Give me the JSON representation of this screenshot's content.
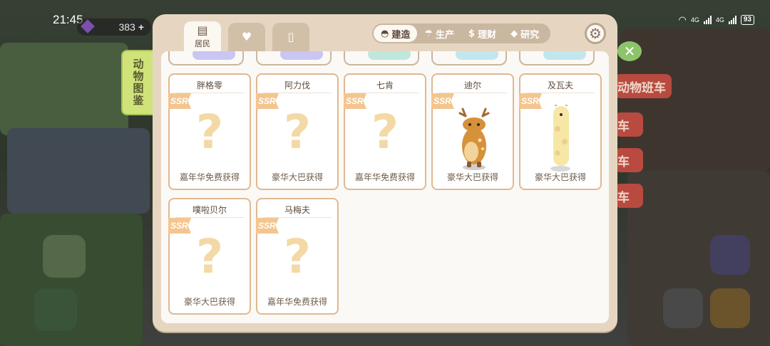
{
  "status_bar": {
    "time": "21:45",
    "network_1": "4G",
    "network_2": "4G",
    "battery": "93"
  },
  "currency": {
    "gems": "383"
  },
  "bookmark": {
    "label": "动物图鉴"
  },
  "background_buttons": [
    "动物班车",
    "车",
    "车",
    "车"
  ],
  "tabs": [
    {
      "label": "居民",
      "icon": "id-card-icon",
      "active": true
    },
    {
      "label": "",
      "icon": "heart-icon",
      "active": false
    },
    {
      "label": "",
      "icon": "jar-icon",
      "active": false
    }
  ],
  "categories": [
    {
      "label": "建造",
      "icon": "helmet-icon",
      "active": true
    },
    {
      "label": "生产",
      "icon": "watering-can-icon",
      "active": false
    },
    {
      "label": "理财",
      "icon": "dollar-icon",
      "active": false
    },
    {
      "label": "研究",
      "icon": "graduation-cap-icon",
      "active": false
    }
  ],
  "settings": {
    "icon": "gear-icon"
  },
  "peek_colors": [
    "#c9c6f2",
    "#c9c6f2",
    "#bfe7dc",
    "#c2e6ee",
    "#c2e6ee"
  ],
  "cards": [
    {
      "name": "胖格零",
      "rarity": "SSR",
      "source": "嘉年华免费获得",
      "unlocked": false
    },
    {
      "name": "阿力伐",
      "rarity": "SSR",
      "source": "豪华大巴获得",
      "unlocked": false
    },
    {
      "name": "七肯",
      "rarity": "SSR",
      "source": "嘉年华免费获得",
      "unlocked": false
    },
    {
      "name": "迪尔",
      "rarity": "SSR",
      "source": "豪华大巴获得",
      "unlocked": true,
      "picture": "deer-icon"
    },
    {
      "name": "及瓦夫",
      "rarity": "SSR",
      "source": "豪华大巴获得",
      "unlocked": true,
      "picture": "giraffe-icon"
    },
    {
      "name": "噗啦贝尔",
      "rarity": "SSR",
      "source": "豪华大巴获得",
      "unlocked": false
    },
    {
      "name": "马梅夫",
      "rarity": "SSR",
      "source": "嘉年华免费获得",
      "unlocked": false
    }
  ],
  "placeholder_glyph": "?",
  "colors": {
    "panel": "#e6d6c1",
    "card_border": "#e0b892",
    "ssr": "#f4c58e",
    "question": "#f3d9a5"
  }
}
